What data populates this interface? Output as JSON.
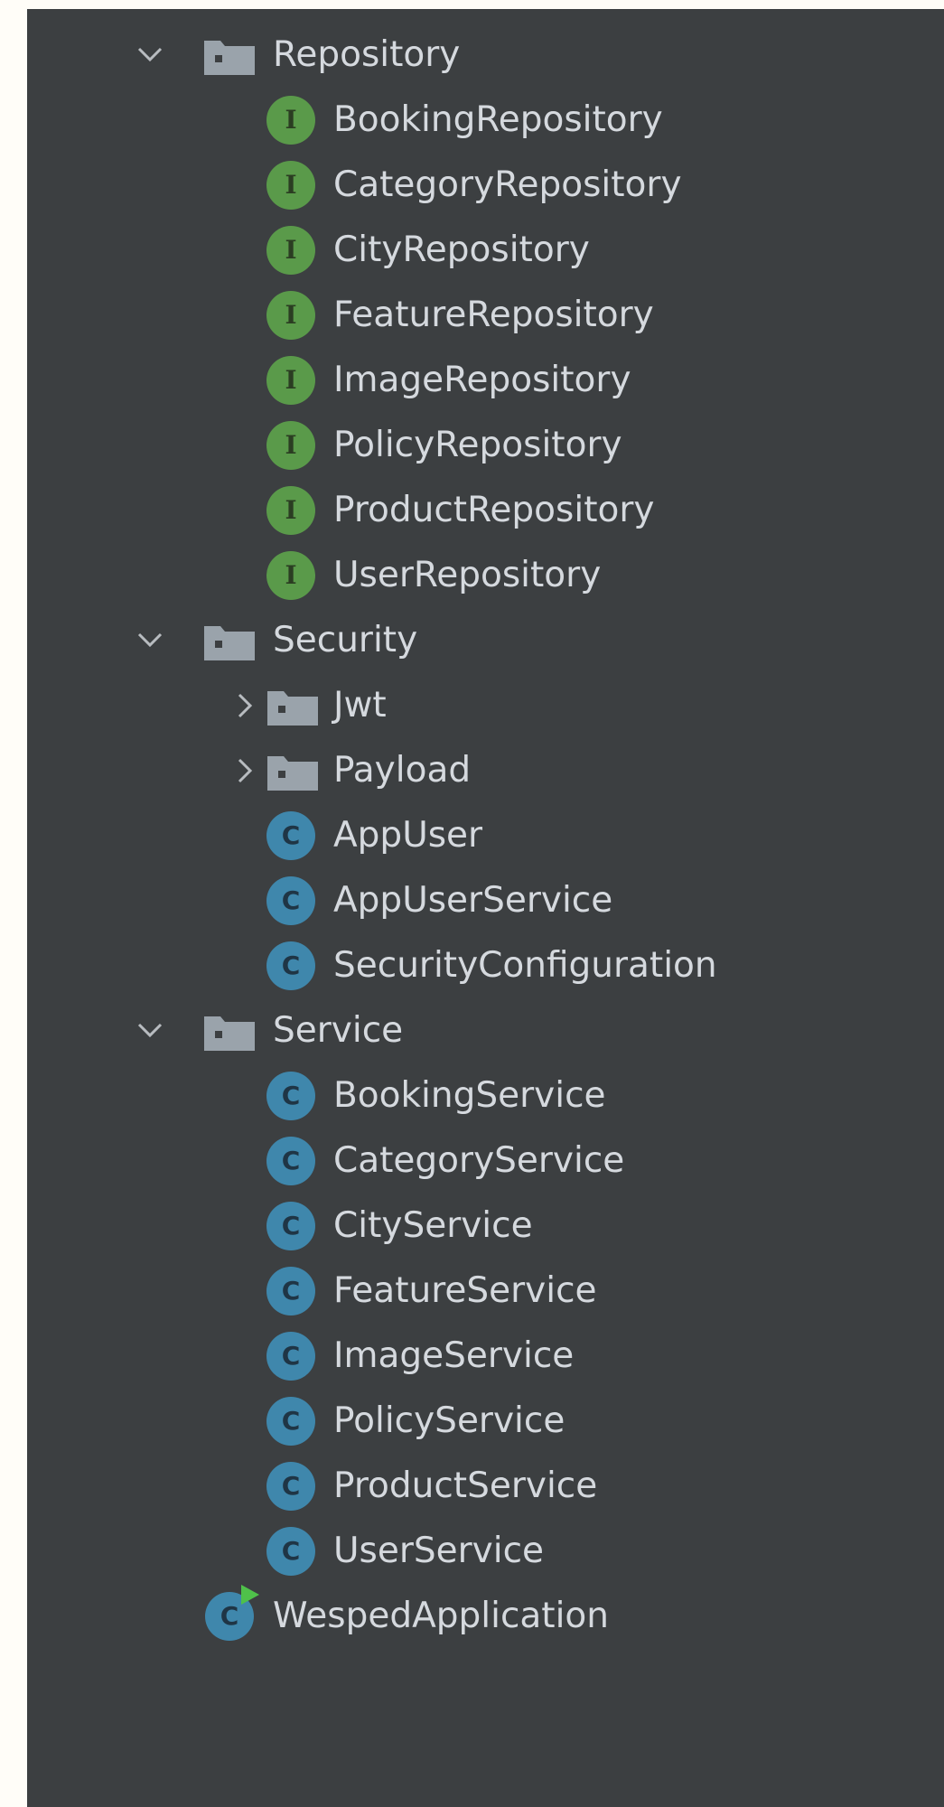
{
  "tree": {
    "repository_folder": {
      "label": "Repository",
      "expanded": true,
      "icon": "folder-icon"
    },
    "repository_items": [
      {
        "label": "BookingRepository",
        "icon": "interface-icon",
        "badge": "I"
      },
      {
        "label": "CategoryRepository",
        "icon": "interface-icon",
        "badge": "I"
      },
      {
        "label": "CityRepository",
        "icon": "interface-icon",
        "badge": "I"
      },
      {
        "label": "FeatureRepository",
        "icon": "interface-icon",
        "badge": "I"
      },
      {
        "label": "ImageRepository",
        "icon": "interface-icon",
        "badge": "I"
      },
      {
        "label": "PolicyRepository",
        "icon": "interface-icon",
        "badge": "I"
      },
      {
        "label": "ProductRepository",
        "icon": "interface-icon",
        "badge": "I"
      },
      {
        "label": "UserRepository",
        "icon": "interface-icon",
        "badge": "I"
      }
    ],
    "security_folder": {
      "label": "Security",
      "expanded": true,
      "icon": "folder-icon"
    },
    "security_subfolders": [
      {
        "label": "Jwt",
        "expanded": false,
        "icon": "folder-icon"
      },
      {
        "label": "Payload",
        "expanded": false,
        "icon": "folder-icon"
      }
    ],
    "security_items": [
      {
        "label": "AppUser",
        "icon": "class-icon",
        "badge": "C"
      },
      {
        "label": "AppUserService",
        "icon": "class-icon",
        "badge": "C"
      },
      {
        "label": "SecurityConfiguration",
        "icon": "class-icon",
        "badge": "C"
      }
    ],
    "service_folder": {
      "label": "Service",
      "expanded": true,
      "icon": "folder-icon"
    },
    "service_items": [
      {
        "label": "BookingService",
        "icon": "class-icon",
        "badge": "C"
      },
      {
        "label": "CategoryService",
        "icon": "class-icon",
        "badge": "C"
      },
      {
        "label": "CityService",
        "icon": "class-icon",
        "badge": "C"
      },
      {
        "label": "FeatureService",
        "icon": "class-icon",
        "badge": "C"
      },
      {
        "label": "ImageService",
        "icon": "class-icon",
        "badge": "C"
      },
      {
        "label": "PolicyService",
        "icon": "class-icon",
        "badge": "C"
      },
      {
        "label": "ProductService",
        "icon": "class-icon",
        "badge": "C"
      },
      {
        "label": "UserService",
        "icon": "class-icon",
        "badge": "C"
      }
    ],
    "main_class": {
      "label": "WespedApplication",
      "icon": "runnable-class-icon",
      "badge": "C"
    }
  },
  "colors": {
    "panel_bg": "#3c3f41",
    "text": "#d5d9de",
    "interface_badge": "#5a9a4a",
    "class_badge": "#3f87ac",
    "folder": "#9aa3ab",
    "chevron": "#b8bcc0",
    "run_marker": "#4fc14a"
  }
}
